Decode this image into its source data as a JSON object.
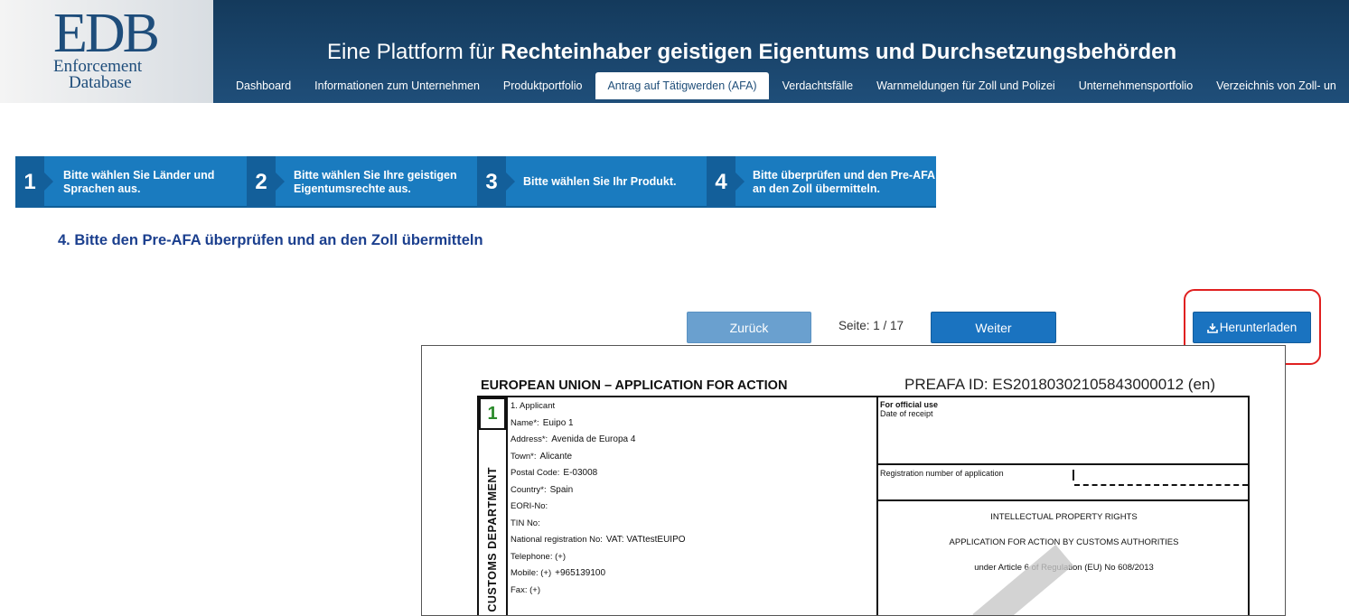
{
  "logo": {
    "main": "EDB",
    "line1": "Enforcement",
    "line2": "Database"
  },
  "header": {
    "tagline_prefix": "Eine Plattform für ",
    "tagline_bold": "Rechteinhaber geistigen Eigentums und Durchsetzungsbehörden"
  },
  "nav": {
    "items": [
      "Dashboard",
      "Informationen zum Unternehmen",
      "Produktportfolio",
      "Antrag auf Tätigwerden (AFA)",
      "Verdachtsfälle",
      "Warnmeldungen für Zoll und Polizei",
      "Unternehmensportfolio",
      "Verzeichnis von Zoll- un"
    ],
    "active_index": 3
  },
  "steps": [
    {
      "num": "1",
      "text": "Bitte wählen Sie Länder und Sprachen aus."
    },
    {
      "num": "2",
      "text": "Bitte wählen Sie Ihre geistigen Eigentumsrechte aus."
    },
    {
      "num": "3",
      "text": "Bitte wählen Sie Ihr Produkt."
    },
    {
      "num": "4",
      "text": "Bitte überprüfen und den Pre-AFA an den Zoll übermitteln."
    }
  ],
  "section_title": "4. Bitte den Pre-AFA überprüfen und an den Zoll übermitteln",
  "pager": {
    "back_label": "Zurück",
    "page_label": "Seite: 1 / 17",
    "next_label": "Weiter",
    "download_label": "Herunterladen"
  },
  "document": {
    "title": "EUROPEAN UNION – APPLICATION FOR ACTION",
    "preafa_id": "PREAFA ID: ES20180302105843000012 (en)",
    "box_number": "1",
    "side_label": "CUSTOMS DEPARTMENT",
    "fields": [
      {
        "label": "1. Applicant",
        "value": ""
      },
      {
        "label": "Name*:",
        "value": "Euipo 1"
      },
      {
        "label": "Address*:",
        "value": "Avenida de Europa 4"
      },
      {
        "label": "Town*:",
        "value": "Alicante"
      },
      {
        "label": "Postal Code:",
        "value": "E-03008"
      },
      {
        "label": "Country*:",
        "value": "Spain"
      },
      {
        "label": "EORI-No:",
        "value": ""
      },
      {
        "label": "TIN No:",
        "value": ""
      },
      {
        "label": "National registration No:",
        "value": "VAT: VATtestEUIPO"
      },
      {
        "label": "Telephone: (+)",
        "value": ""
      },
      {
        "label": "Mobile: (+)",
        "value": "+965139100"
      },
      {
        "label": "Fax: (+)",
        "value": ""
      }
    ],
    "official": {
      "heading": "For official use",
      "date_label": "Date of receipt",
      "reg_label": "Registration number of application",
      "ipr_line1": "INTELLECTUAL PROPERTY RIGHTS",
      "ipr_line2": "APPLICATION FOR ACTION BY CUSTOMS AUTHORITIES",
      "ipr_line3": "under Article 6 of Regulation (EU) No 608/2013"
    }
  },
  "colors": {
    "header": "#1f4e79",
    "steps": "#1a7bbf",
    "button": "#1a73c0",
    "highlight": "#e02020"
  }
}
